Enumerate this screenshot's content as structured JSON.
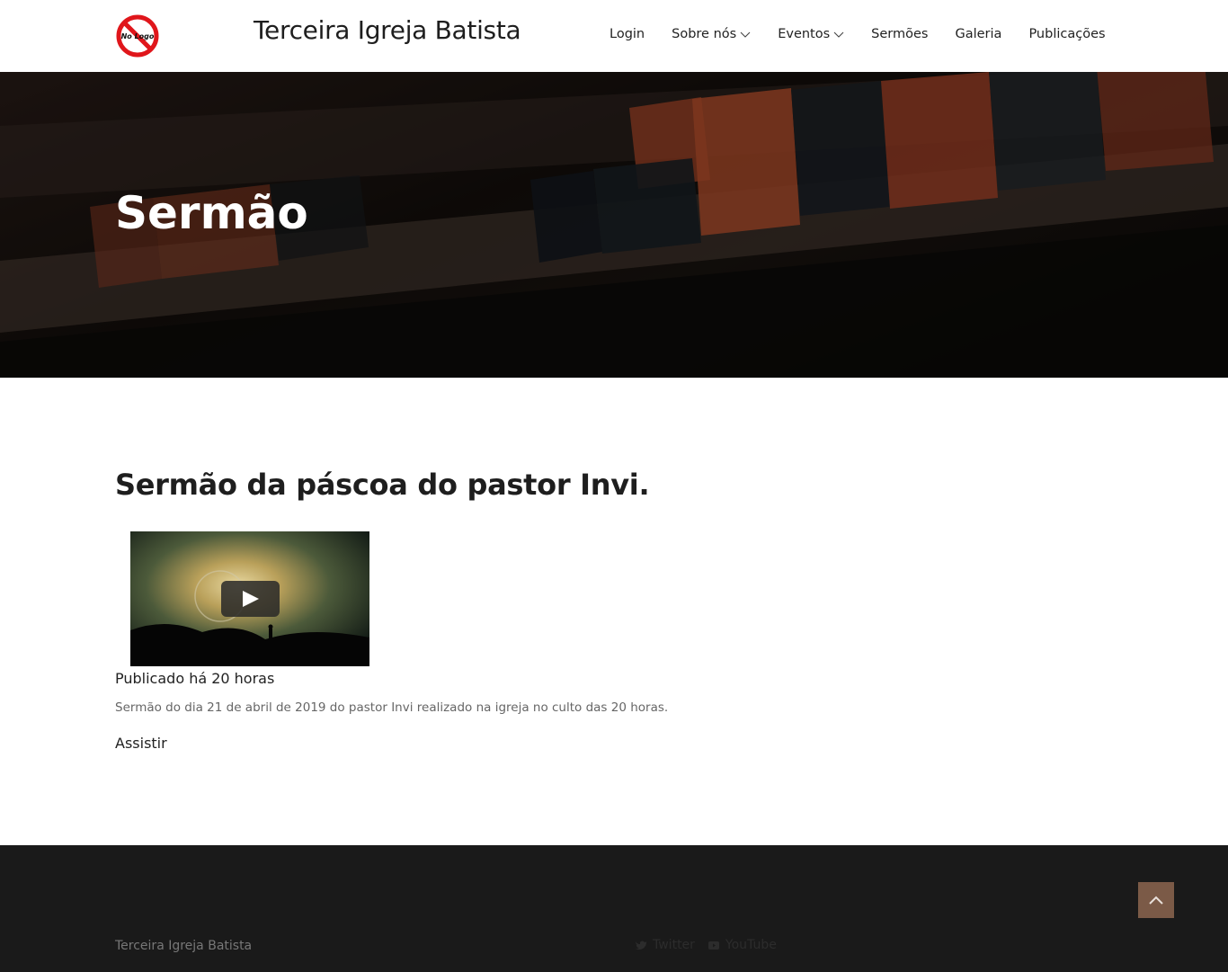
{
  "header": {
    "logo_text": "No Logo",
    "site_title": "Terceira Igreja Batista",
    "nav": [
      {
        "label": "Login",
        "has_dropdown": false
      },
      {
        "label": "Sobre nós",
        "has_dropdown": true
      },
      {
        "label": "Eventos",
        "has_dropdown": true
      },
      {
        "label": "Sermões",
        "has_dropdown": false
      },
      {
        "label": "Galeria",
        "has_dropdown": false
      },
      {
        "label": "Publicações",
        "has_dropdown": false
      }
    ]
  },
  "hero": {
    "title": "Sermão"
  },
  "sermon": {
    "title": "Sermão da páscoa do pastor Invi.",
    "video_icon": "play-icon",
    "published": "Publicado há 20 horas",
    "description": "Sermão do dia 21 de abril de 2019 do pastor Invi realizado na igreja no culto das 20 horas.",
    "watch_label": "Assistir"
  },
  "footer": {
    "brand": "Terceira Igreja Batista",
    "social": [
      {
        "label": "Twitter",
        "icon": "twitter-icon"
      },
      {
        "label": "YouTube",
        "icon": "youtube-icon"
      }
    ],
    "to_top_icon": "chevron-up-icon"
  },
  "colors": {
    "footer_bg": "#1a1a1a",
    "to_top_bg": "#7b5a47",
    "hero_overlay": "#140f0c"
  }
}
